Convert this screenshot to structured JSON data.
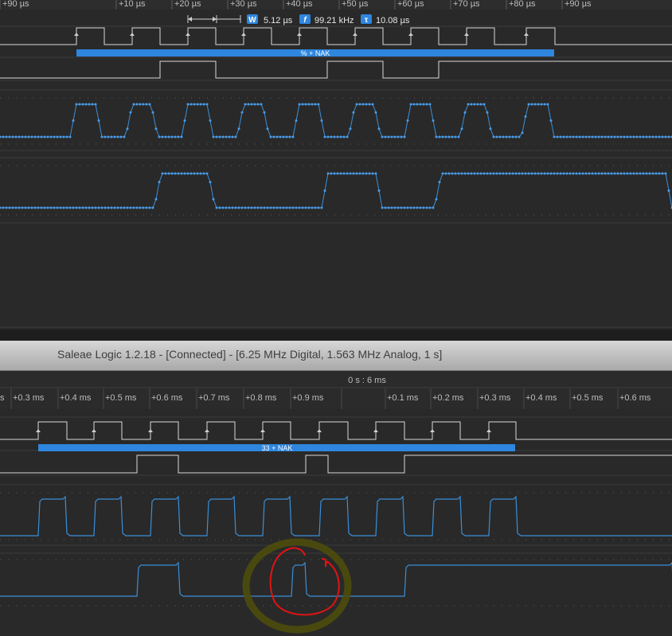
{
  "window": {
    "title": "Saleae Logic 1.2.18 - [Connected] - [6.25 MHz Digital, 1.563 MHz Analog, 1 s]"
  },
  "top_view": {
    "time_ticks": [
      "+90 µs",
      "+10 µs",
      "+20 µs",
      "+30 µs",
      "+40 µs",
      "+50 µs",
      "+60 µs",
      "+70 µs",
      "+80 µs",
      "+90 µs"
    ],
    "measurements": [
      {
        "icon": "W",
        "value": "5.12 µs"
      },
      {
        "icon": "f",
        "value": "99.21 kHz"
      },
      {
        "icon": "τ",
        "value": "10.08 µs"
      }
    ],
    "protocol_label": "% + NAK"
  },
  "bottom_view": {
    "time_center": "0 s : 6 ms",
    "time_ticks": [
      "s",
      "+0.3 ms",
      "+0.4 ms",
      "+0.5 ms",
      "+0.6 ms",
      "+0.7 ms",
      "+0.8 ms",
      "+0.9 ms",
      "+0.1 ms",
      "+0.2 ms",
      "+0.3 ms",
      "+0.4 ms",
      "+0.5 ms",
      "+0.6 ms"
    ],
    "protocol_label": "33 + NAK"
  },
  "colors": {
    "accent": "#2e86de",
    "digital_line": "#d9d9d9",
    "analog_line": "#3b8fd9",
    "annotation_red": "#e01414",
    "annotation_olive": "#5a5a10"
  }
}
